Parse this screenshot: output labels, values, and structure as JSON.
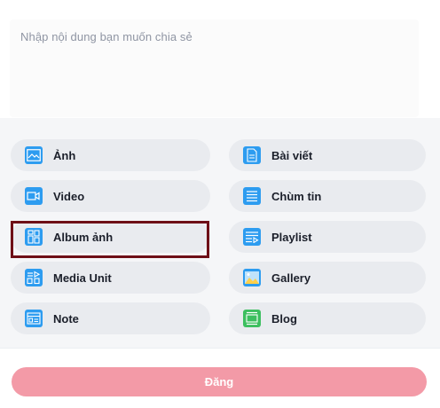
{
  "compose": {
    "placeholder": "Nhập nội dung bạn muốn chia sẻ"
  },
  "options": {
    "left": [
      {
        "label": "Ảnh",
        "icon": "image-icon",
        "color": "#2d9cf0"
      },
      {
        "label": "Video",
        "icon": "video-icon",
        "color": "#2d9cf0"
      },
      {
        "label": "Album ảnh",
        "icon": "album-icon",
        "color": "#2d9cf0"
      },
      {
        "label": "Media Unit",
        "icon": "media-unit-icon",
        "color": "#2d9cf0"
      },
      {
        "label": "Note",
        "icon": "note-icon",
        "color": "#2d9cf0"
      }
    ],
    "right": [
      {
        "label": "Bài viết",
        "icon": "article-icon",
        "color": "#2d9cf0"
      },
      {
        "label": "Chùm tin",
        "icon": "news-cluster-icon",
        "color": "#2d9cf0"
      },
      {
        "label": "Playlist",
        "icon": "playlist-icon",
        "color": "#2d9cf0"
      },
      {
        "label": "Gallery",
        "icon": "gallery-icon",
        "color": "#2d9cf0"
      },
      {
        "label": "Blog",
        "icon": "blog-icon",
        "color": "#3cbf5f"
      }
    ],
    "selected": "Album ảnh"
  },
  "post_button": {
    "label": "Đăng",
    "color": "#f39aa7"
  }
}
